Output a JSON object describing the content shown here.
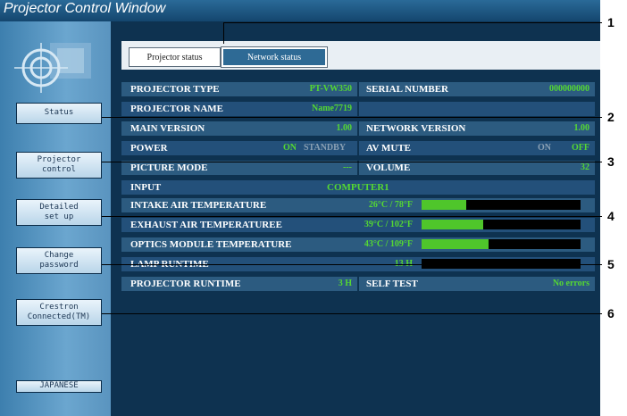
{
  "window": {
    "title": "Projector Control Window"
  },
  "sidebar": {
    "buttons": [
      {
        "label": "Status"
      },
      {
        "label": "Projector\ncontrol"
      },
      {
        "label": "Detailed\nset up"
      },
      {
        "label": "Change\npassword"
      },
      {
        "label": "Crestron\nConnected(TM)"
      },
      {
        "label": "JAPANESE"
      }
    ]
  },
  "tabs": [
    {
      "label": "Projector status",
      "active": false
    },
    {
      "label": "Network status",
      "active": true
    }
  ],
  "status": {
    "projector_type": {
      "label": "PROJECTOR TYPE",
      "value": "PT-VW350"
    },
    "serial_number": {
      "label": "SERIAL NUMBER",
      "value": "000000000"
    },
    "projector_name": {
      "label": "PROJECTOR NAME",
      "value": "Name7719"
    },
    "main_version": {
      "label": "MAIN VERSION",
      "value": "1.00"
    },
    "network_version": {
      "label": "NETWORK VERSION",
      "value": "1.00"
    },
    "power": {
      "label": "POWER",
      "on": "ON",
      "standby": "STANDBY"
    },
    "av_mute": {
      "label": "AV MUTE",
      "on": "ON",
      "off": "OFF"
    },
    "picture_mode": {
      "label": "PICTURE MODE",
      "value": "---"
    },
    "volume": {
      "label": "VOLUME",
      "value": "32"
    },
    "input": {
      "label": "INPUT",
      "value": "COMPUTER1"
    },
    "intake_temp": {
      "label": "INTAKE AIR TEMPERATURE",
      "value": "26°C / 78°F",
      "level": 0.28
    },
    "exhaust_temp": {
      "label": "EXHAUST AIR TEMPERATUREE",
      "value": "39°C / 102°F",
      "level": 0.39
    },
    "optics_temp": {
      "label": "OPTICS MODULE TEMPERATURE",
      "value": "43°C / 109°F",
      "level": 0.42
    },
    "lamp_runtime": {
      "label": "LAMP RUNTIME",
      "value": "13 H",
      "level": 0.0
    },
    "projector_runtime": {
      "label": "PROJECTOR RUNTIME",
      "value": "3 H"
    },
    "self_test": {
      "label": "SELF TEST",
      "value": "No errors"
    }
  },
  "colors": {
    "value_green": "#55d832",
    "inactive_gray": "#8aa0b4",
    "bar_fill": "#4fc62b"
  },
  "callouts": [
    "1",
    "2",
    "3",
    "4",
    "5",
    "6"
  ]
}
